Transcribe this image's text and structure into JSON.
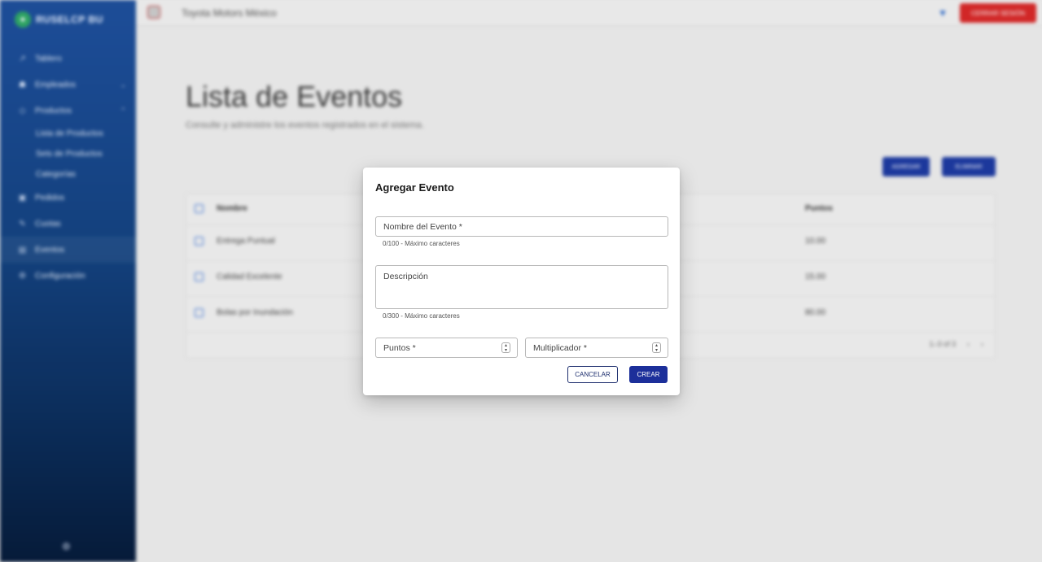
{
  "sidebar": {
    "brand": "RUSELCP BU",
    "items": [
      {
        "label": "Tablero",
        "icon": "chart-icon"
      },
      {
        "label": "Empleados",
        "icon": "people-icon"
      },
      {
        "label": "Productos",
        "icon": "tag-icon"
      },
      {
        "label": "Pedidos",
        "icon": "cart-icon"
      },
      {
        "label": "Cuotas",
        "icon": "edit-icon"
      },
      {
        "label": "Eventos",
        "icon": "calendar-icon"
      },
      {
        "label": "Configuración",
        "icon": "gear-icon"
      }
    ],
    "subitems": [
      "Lista de Productos",
      "Sets de Productos",
      "Categorías"
    ]
  },
  "topbar": {
    "title": "Toyota Motors México",
    "logout_label": "Cerrar sesión",
    "filter_icon": "▼"
  },
  "page": {
    "title": "Lista de Eventos",
    "subtitle": "Consulte y administre los eventos registrados en el sistema.",
    "add_label": "Agregar",
    "delete_label": "Eliminar"
  },
  "table": {
    "headers": [
      "Nombre",
      "Puntos"
    ],
    "rows": [
      {
        "name": "Entrega Puntual",
        "points": "10.00"
      },
      {
        "name": "Calidad Excelente",
        "points": "15.00"
      },
      {
        "name": "Bolas por Inundación",
        "points": "80.00"
      }
    ],
    "pagination": "1–3 of 3"
  },
  "dialog": {
    "title": "Agregar Evento",
    "name_placeholder": "Nombre del Evento *",
    "name_helper": "0/100 - Máximo caracteres",
    "description_placeholder": "Descripción",
    "description_helper": "0/300 - Máximo caracteres",
    "points_placeholder": "Puntos *",
    "multiplier_placeholder": "Multiplicador *",
    "cancel_label": "CANCELAR",
    "create_label": "CREAR"
  }
}
